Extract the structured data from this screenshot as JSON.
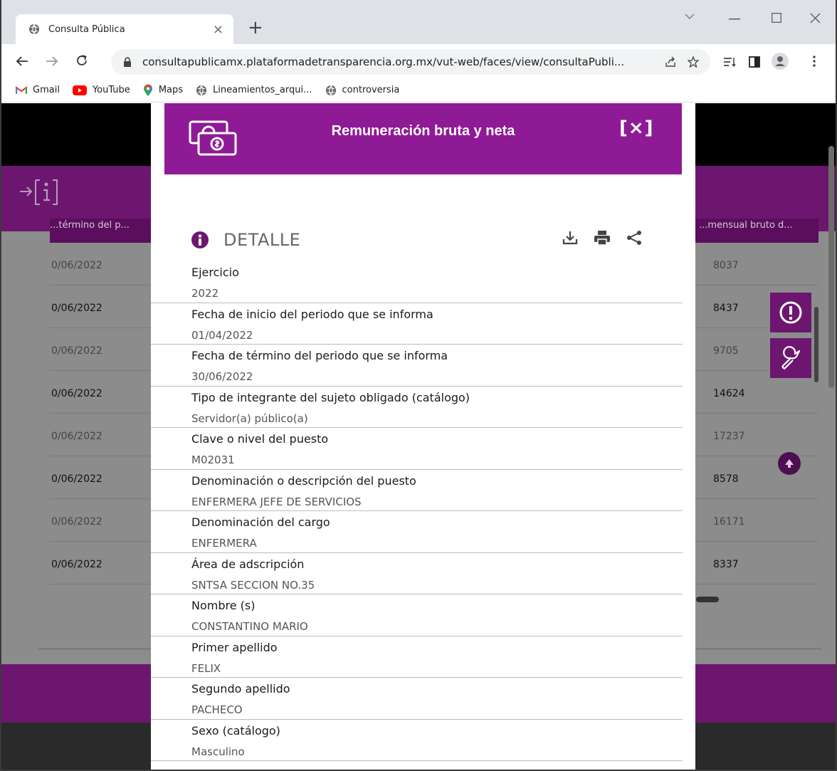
{
  "browser": {
    "tab_title": "Consulta Pública",
    "tab_close": "×",
    "new_tab": "+",
    "url": "consultapublicamx.plataformadetransparencia.org.mx/vut-web/faces/view/consultaPubli...",
    "bookmarks": [
      {
        "label": "Gmail",
        "icon": "gmail-icon"
      },
      {
        "label": "YouTube",
        "icon": "youtube-icon"
      },
      {
        "label": "Maps",
        "icon": "maps-icon"
      },
      {
        "label": "Lineamientos_arqui...",
        "icon": "globe-icon"
      },
      {
        "label": "controversia",
        "icon": "globe-icon"
      }
    ]
  },
  "background_table": {
    "head_left": "...término del p...",
    "head_right": "...mensual bruto d...",
    "rows": [
      {
        "date": "0/06/2022",
        "amount": "8037",
        "tone": "light"
      },
      {
        "date": "0/06/2022",
        "amount": "8437",
        "tone": "dark"
      },
      {
        "date": "0/06/2022",
        "amount": "9705",
        "tone": "light"
      },
      {
        "date": "0/06/2022",
        "amount": "14624",
        "tone": "dark"
      },
      {
        "date": "0/06/2022",
        "amount": "17237",
        "tone": "light"
      },
      {
        "date": "0/06/2022",
        "amount": "8578",
        "tone": "dark"
      },
      {
        "date": "0/06/2022",
        "amount": "16171",
        "tone": "light"
      },
      {
        "date": "0/06/2022",
        "amount": "8337",
        "tone": "dark"
      }
    ]
  },
  "modal": {
    "title": "Remuneración bruta y neta",
    "close_label": "[×]",
    "section_title": "DETALLE",
    "fields": [
      {
        "label": "Ejercicio",
        "value": "2022"
      },
      {
        "label": "Fecha de inicio del periodo que se informa",
        "value": "01/04/2022"
      },
      {
        "label": "Fecha de término del periodo que se informa",
        "value": "30/06/2022"
      },
      {
        "label": "Tipo de integrante del sujeto obligado (catálogo)",
        "value": "Servidor(a) público(a)"
      },
      {
        "label": "Clave o nivel del puesto",
        "value": "M02031"
      },
      {
        "label": "Denominación o descripción del puesto",
        "value": "ENFERMERA JEFE DE SERVICIOS"
      },
      {
        "label": "Denominación del cargo",
        "value": "ENFERMERA"
      },
      {
        "label": "Área de adscripción",
        "value": "SNTSA SECCION NO.35"
      },
      {
        "label": "Nombre (s)",
        "value": "CONSTANTINO MARIO"
      },
      {
        "label": "Primer apellido",
        "value": "FELIX"
      },
      {
        "label": "Segundo apellido",
        "value": "PACHECO"
      },
      {
        "label": "Sexo (catálogo)",
        "value": "Masculino"
      }
    ]
  },
  "colors": {
    "modal_header": "#8e1b95",
    "page_purple": "#6d1670",
    "overlay": "#8c8c8c"
  }
}
